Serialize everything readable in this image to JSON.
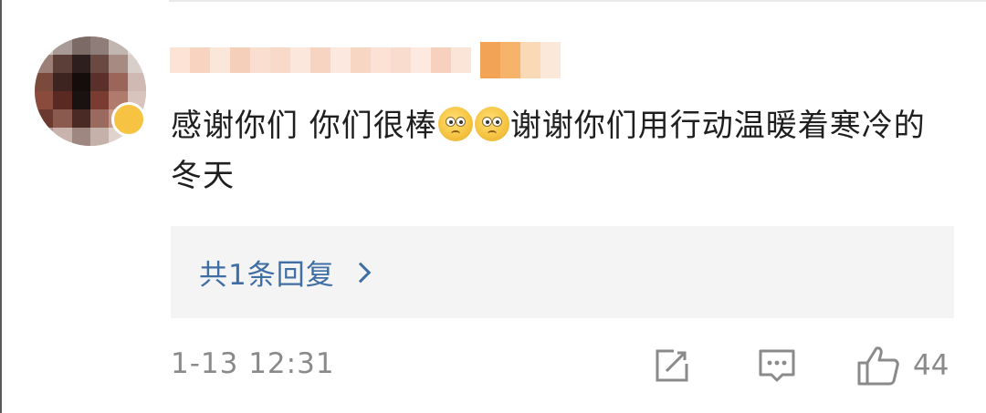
{
  "comment": {
    "text_part1": "感谢你们  你们很棒",
    "emojis": [
      "worried-face",
      "worried-face"
    ],
    "text_part2": "谢谢你们用行动温暖着寒冷的冬天"
  },
  "replies": {
    "label": "共1条回复"
  },
  "footer": {
    "timestamp": "1-13 12:31",
    "like_count": "44"
  },
  "icons": {
    "share": "share-icon",
    "comment": "comment-icon",
    "like": "thumbs-up-icon",
    "chevron": "chevron-right-icon"
  },
  "colors": {
    "link": "#3e6ea3",
    "muted": "#8a8a8a",
    "reply_bg": "#f4f4f4"
  }
}
